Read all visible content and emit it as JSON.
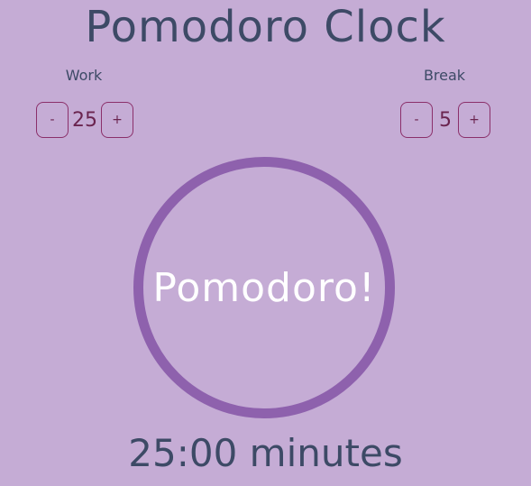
{
  "app": {
    "title": "Pomodoro Clock"
  },
  "work": {
    "label": "Work",
    "decrement": "-",
    "value": "25",
    "increment": "+"
  },
  "break": {
    "label": "Break",
    "decrement": "-",
    "value": "5",
    "increment": "+"
  },
  "timer": {
    "circle_text": "Pomodoro!",
    "display": "25:00 minutes"
  },
  "colors": {
    "background": "#c5acd5",
    "title_text": "#3d4a66",
    "control_accent": "#8b2f6a",
    "circle_border": "#8e61ad",
    "circle_text": "#ffffff"
  }
}
